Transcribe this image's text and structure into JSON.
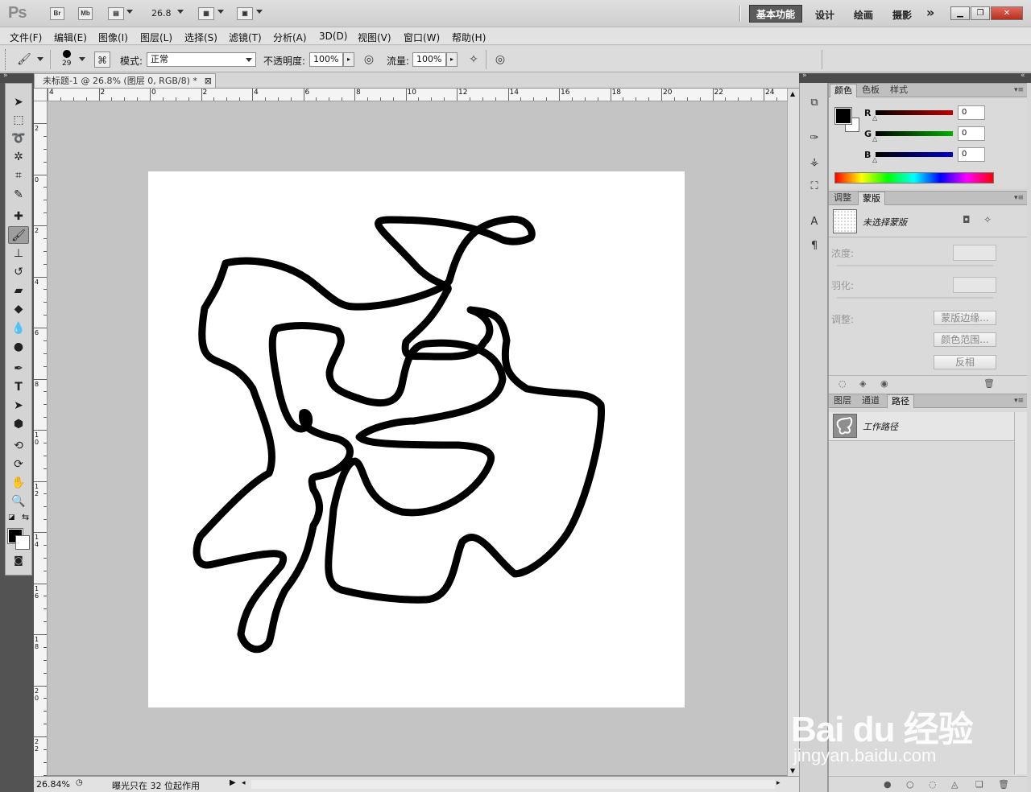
{
  "app": {
    "logo": "Ps",
    "bridge_label": "Br",
    "minibridge_label": "Mb",
    "zoom": "26.8",
    "workspaces": {
      "active": "基本功能",
      "items": [
        "设计",
        "绘画",
        "摄影"
      ],
      "more": "»"
    }
  },
  "menu": [
    "文件(F)",
    "编辑(E)",
    "图像(I)",
    "图层(L)",
    "选择(S)",
    "滤镜(T)",
    "分析(A)",
    "3D(D)",
    "视图(V)",
    "窗口(W)",
    "帮助(H)"
  ],
  "options": {
    "brush_size": "29",
    "mode_label": "模式:",
    "mode_value": "正常",
    "opacity_label": "不透明度:",
    "opacity_value": "100%",
    "flow_label": "流量:",
    "flow_value": "100%"
  },
  "document": {
    "tab_title": "未标题-1 @ 26.8% (图层 0, RGB/8) *",
    "close": "⊠",
    "hruler_labels": [
      "4",
      "2",
      "0",
      "2",
      "4",
      "6",
      "8",
      "10",
      "12",
      "14",
      "16",
      "18",
      "20",
      "22",
      "24"
    ],
    "vruler_labels": [
      "2",
      "0",
      "2",
      "4",
      "6",
      "8",
      "1\n0",
      "1\n2",
      "1\n4",
      "1\n6",
      "1\n8",
      "2\n0",
      "2\n2"
    ]
  },
  "status": {
    "zoom": "26.84%",
    "message": "曝光只在 32 位起作用"
  },
  "color_panel": {
    "tabs": [
      "颜色",
      "色板",
      "样式"
    ],
    "active_tab": "颜色",
    "channels": [
      {
        "label": "R",
        "value": "0",
        "color": "#c00000"
      },
      {
        "label": "G",
        "value": "0",
        "color": "#00b000"
      },
      {
        "label": "B",
        "value": "0",
        "color": "#0000c8"
      }
    ]
  },
  "mask_panel": {
    "tabs": [
      "调整",
      "蒙版"
    ],
    "active_tab": "蒙版",
    "mask_name": "未选择蒙版",
    "density_label": "浓度:",
    "feather_label": "羽化:",
    "refine_label": "调整:",
    "btn_edge": "蒙版边缘...",
    "btn_range": "颜色范围...",
    "btn_invert": "反相"
  },
  "layers_panel": {
    "tabs": [
      "图层",
      "通道",
      "路径"
    ],
    "active_tab": "路径",
    "path_name": "工作路径"
  },
  "watermark": {
    "brand": "Bai du 经验",
    "url": "jingyan.baidu.com"
  }
}
